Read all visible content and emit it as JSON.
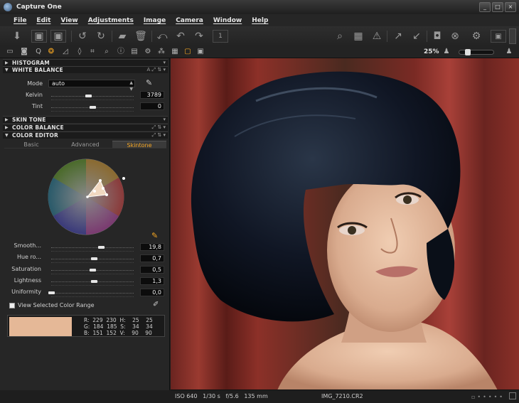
{
  "window": {
    "title": "Capture One",
    "controls": [
      "_",
      "□",
      "×"
    ]
  },
  "menu": [
    "File",
    "Edit",
    "View",
    "Adjustments",
    "Image",
    "Camera",
    "Window",
    "Help"
  ],
  "toolbar": {
    "zoom": "25%"
  },
  "panel": {
    "sections": {
      "histogram": "HISTOGRAM",
      "white_balance": "WHITE BALANCE",
      "skin_tone": "SKIN TONE",
      "color_balance": "COLOR BALANCE",
      "color_editor": "COLOR EDITOR"
    },
    "white_balance": {
      "mode_label": "Mode",
      "mode_value": "auto",
      "kelvin_label": "Kelvin",
      "kelvin_value": "3789",
      "kelvin_level": 0.45,
      "tint_label": "Tint",
      "tint_value": "0",
      "tint_level": 0.5
    },
    "color_editor": {
      "tabs": [
        "Basic",
        "Advanced",
        "Skintone"
      ],
      "active_tab": "Skintone",
      "sliders": [
        {
          "label": "Smooth...",
          "value": "19,8",
          "level": 0.6
        },
        {
          "label": "Hue ro...",
          "value": "0,7",
          "level": 0.52
        },
        {
          "label": "Saturation",
          "value": "0,5",
          "level": 0.5
        },
        {
          "label": "Lightness",
          "value": "1,3",
          "level": 0.52
        },
        {
          "label": "Uniformity",
          "value": "0,0",
          "level": 0.0
        }
      ],
      "view_selected_label": "View Selected Color Range",
      "swatch_color": "#e5b897",
      "readout": {
        "r": "R:  229  230  H:    25    25",
        "g": "G:  184  185  S:    34    34",
        "b": "B:  151  152  V:    90    90"
      }
    }
  },
  "status": {
    "exif": "ISO 640   1/30 s   f/5.6   135 mm",
    "filename": "IMG_7210.CR2"
  },
  "colors": {
    "accent": "#f5a623",
    "panel": "#262626",
    "background": "#1e1e1e"
  }
}
